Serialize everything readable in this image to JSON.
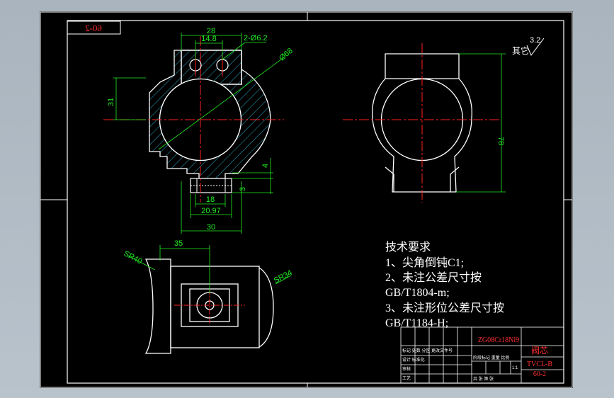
{
  "drawing": {
    "sheet_code": "60-2",
    "roughness": {
      "other_label": "其它",
      "value": "3.2"
    },
    "dimensions": {
      "d28": "28",
      "d14_8": "14.8",
      "holes": "2-Ø6.2",
      "dia68": "Ø68",
      "d31": "31",
      "d4": "4",
      "d3": "3",
      "d18": "18",
      "d20_97": "20.97",
      "d30": "30",
      "d78": "78",
      "d35": "35",
      "sr40": "SR40",
      "sr34": "SR34"
    },
    "tech_requirements": {
      "title": "技术要求",
      "lines": [
        "1、尖角倒钝C1;",
        "2、未注公差尺寸按",
        "GB/T1804-m;",
        "3、未注形位公差尺寸按",
        "GB/T1184-H;"
      ]
    },
    "title_block": {
      "material": "ZG08Cr18Ni9",
      "part_name": "阀芯",
      "drawing_no": "TVCL-B",
      "sheet_no": "60-2",
      "small_labels": [
        "标记 处数 分区 更改文件号",
        "设计 标准化",
        "审核",
        "工艺",
        "阶段标记 重量 比例",
        "共 张 第 张",
        "1:1"
      ]
    }
  },
  "colors": {
    "background": "#000000",
    "outline": "#ffffff",
    "dimension": "#22ee22",
    "centerline": "#ff2020",
    "hatch": "#2aa9c8",
    "annotation_red": "#ff3030",
    "chrome": "#b0bac4"
  }
}
